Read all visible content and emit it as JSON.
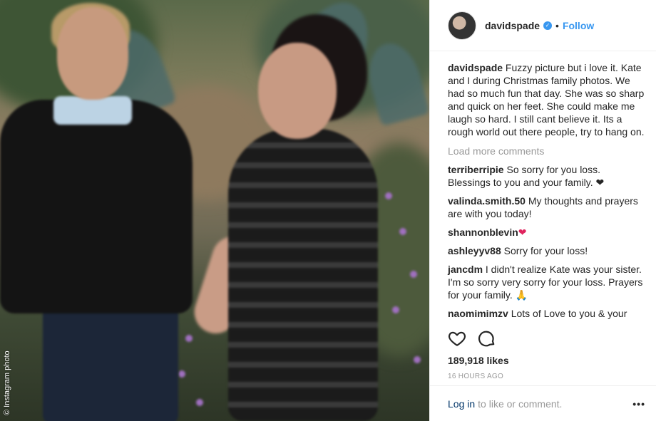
{
  "photo": {
    "credit": "© Instagram photo"
  },
  "header": {
    "username": "davidspade",
    "separator": "•",
    "follow_label": "Follow"
  },
  "caption": {
    "username": "davidspade",
    "text": "Fuzzy picture but i love it. Kate and I during Christmas family photos. We had so much fun that day. She was so sharp and quick on her feet. She could make me laugh so hard. I still cant believe it. Its a rough world out there people, try to hang on."
  },
  "load_more": "Load more comments",
  "comments": [
    {
      "username": "terriberripie",
      "text": "So sorry for you loss. Blessings to you and your family. ❤"
    },
    {
      "username": "valinda.smith.50",
      "text": "My thoughts and prayers are with you today!"
    },
    {
      "username": "shannonblevin",
      "text": "❤"
    },
    {
      "username": "ashleyyv88",
      "text": "Sorry for your loss!"
    },
    {
      "username": "jancdm",
      "text": "I didn't realize Kate was your sister. I'm so sorry very sorry for your loss. Prayers for your family. 🙏"
    },
    {
      "username": "naomimimzv",
      "text": "Lots of Love to you & your"
    }
  ],
  "likes": "189,918 likes",
  "timestamp": "16 HOURS AGO",
  "footer": {
    "login_label": "Log in",
    "rest_text": "to like or comment.",
    "more_label": "•••"
  },
  "icons": {
    "like": "heart-icon",
    "comment": "comment-bubble-icon",
    "verified": "verified-badge-icon"
  },
  "colors": {
    "link": "#3897f0",
    "login": "#003569",
    "muted": "#999999"
  }
}
